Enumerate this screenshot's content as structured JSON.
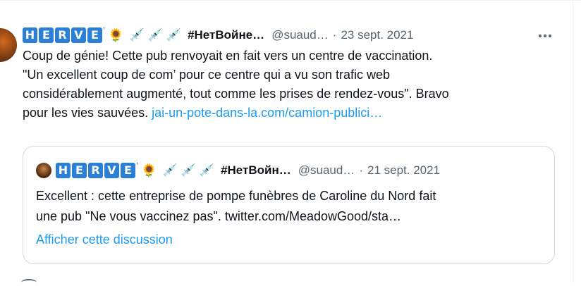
{
  "tweet": {
    "author": {
      "badge_letters": [
        "H",
        "E",
        "R",
        "V",
        "E"
      ],
      "tick": "ʼ",
      "emoji": "🌻",
      "syringes": [
        "💉",
        "💉",
        "💉"
      ],
      "display_name": "#НетВойне…",
      "handle": "@suaud…",
      "separator": "·",
      "date": "23 sept. 2021"
    },
    "more_label": "More",
    "text_lines": [
      "Coup de génie! Cette pub renvoyait en fait vers un centre de vaccination.",
      "\"Un excellent coup de com’ pour ce centre qui a vu son trafic web",
      "considérablement augmenté, tout comme les prises de rendez-vous\". Bravo"
    ],
    "last_line_text": "pour les vies sauvées. ",
    "link_text": "jai-un-pote-dans-la.com/camion-publici…"
  },
  "quote": {
    "author": {
      "badge_letters": [
        "H",
        "E",
        "R",
        "V",
        "E"
      ],
      "tick": "ʼ",
      "emoji": "🌻",
      "syringes": [
        "💉",
        "💉",
        "💉"
      ],
      "display_name": "#НетВойн…",
      "handle": "@suaud…",
      "separator": "·",
      "date": "21 sept. 2021"
    },
    "text_line1": "Excellent : cette entreprise de pompe funèbres de Caroline du Nord fait",
    "text_line2": "une pub \"Ne vous vaccinez pas\". twitter.com/MeadowGood/sta…",
    "show_thread": "Afficher cette discussion"
  },
  "colors": {
    "accent": "#1d9bf0",
    "text": "#0f1419",
    "muted": "#536471",
    "badge": "#2b7fd4",
    "border": "#cfd9de"
  }
}
